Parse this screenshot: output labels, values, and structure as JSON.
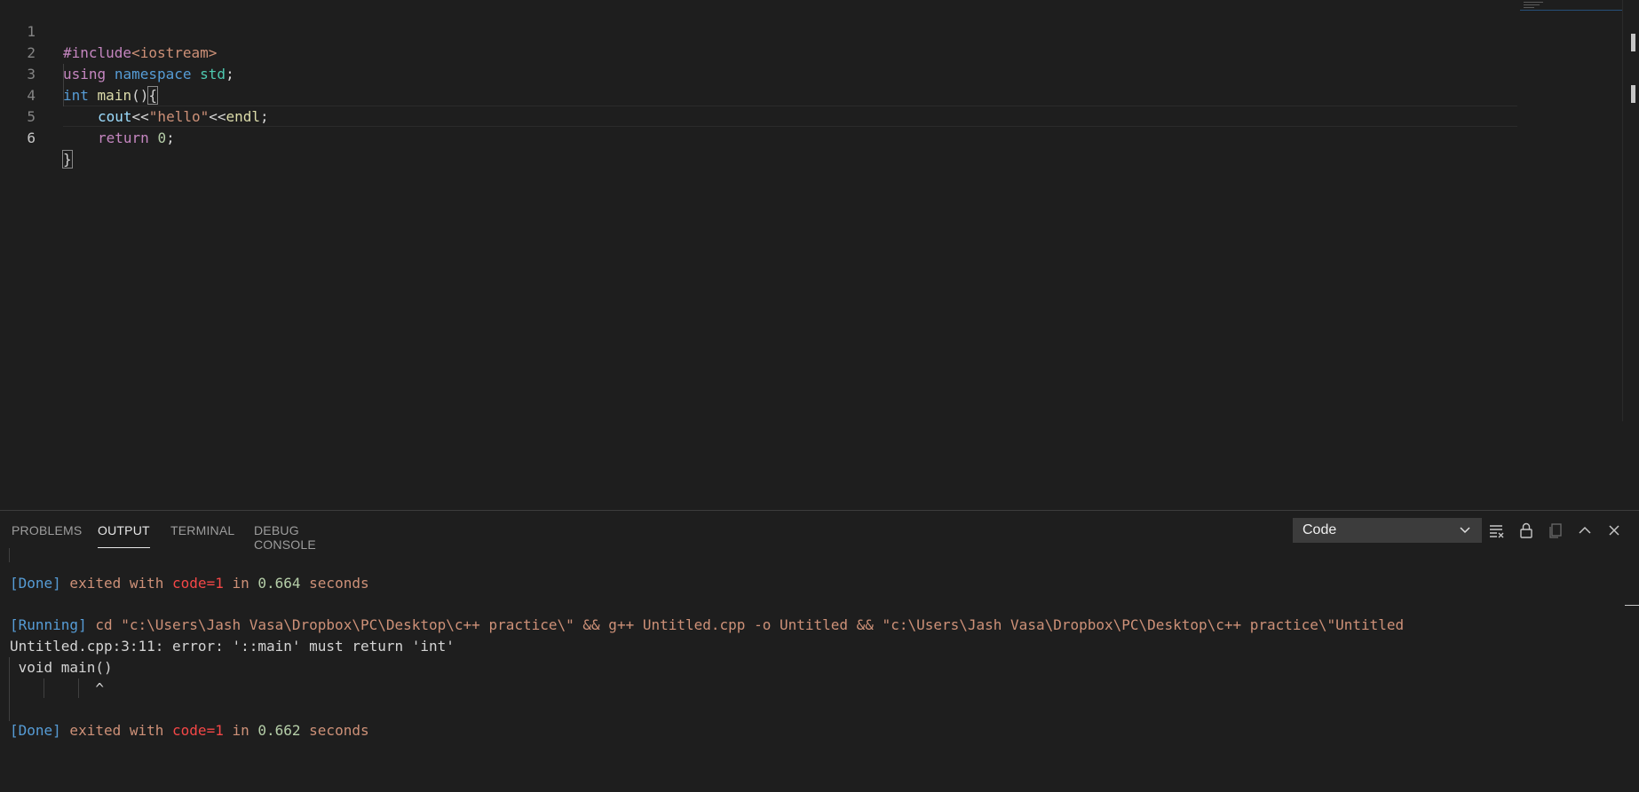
{
  "editor": {
    "lines": [
      {
        "n": "1"
      },
      {
        "n": "2"
      },
      {
        "n": "3"
      },
      {
        "n": "4"
      },
      {
        "n": "5"
      },
      {
        "n": "6"
      }
    ],
    "tokens": {
      "l1_pre": "#include",
      "l1_hdr": "<iostream>",
      "l2_using": "using",
      "l2_ns": "namespace",
      "l2_std": "std",
      "l2_semi": ";",
      "l3_int": "int",
      "l3_main": "main",
      "l3_paren": "()",
      "l3_brace": "{",
      "l4_cout": "cout",
      "l4_op1": "<<",
      "l4_str": "\"hello\"",
      "l4_op2": "<<",
      "l4_endl": "endl",
      "l4_semi": ";",
      "l5_ret": "return",
      "l5_num": "0",
      "l5_semi": ";",
      "l6_brace": "}"
    }
  },
  "panel": {
    "tabs": [
      {
        "label": "PROBLEMS"
      },
      {
        "label": "OUTPUT"
      },
      {
        "label": "TERMINAL"
      },
      {
        "label": "DEBUG CONSOLE"
      }
    ],
    "active_tab": "OUTPUT",
    "channel": "Code",
    "tool_icons": [
      "clear-output-icon",
      "lock-icon",
      "copy-icon",
      "chevron-up-icon",
      "close-icon"
    ],
    "output": {
      "done1_tag": "[Done]",
      "done1_text": " exited with ",
      "done1_code": "code=1",
      "done1_in": " in ",
      "done1_num": "0.664",
      "done1_sec": " seconds",
      "run_tag": "[Running]",
      "run_cmd": " cd \"c:\\Users\\Jash Vasa\\Dropbox\\PC\\Desktop\\c++ practice\\\" && g++ Untitled.cpp -o Untitled && \"c:\\Users\\Jash Vasa\\Dropbox\\PC\\Desktop\\c++ practice\\\"Untitled",
      "error_line": "Untitled.cpp:3:11: error: '::main' must return 'int'",
      "src_line": " void main()",
      "caret_line": "          ^",
      "done2_tag": "[Done]",
      "done2_text": " exited with ",
      "done2_code": "code=1",
      "done2_in": " in ",
      "done2_num": "0.662",
      "done2_sec": " seconds"
    }
  },
  "colors": {
    "background": "#1e1e1e",
    "keyword": "#569cd6",
    "string": "#ce9178",
    "error": "#f44747"
  }
}
